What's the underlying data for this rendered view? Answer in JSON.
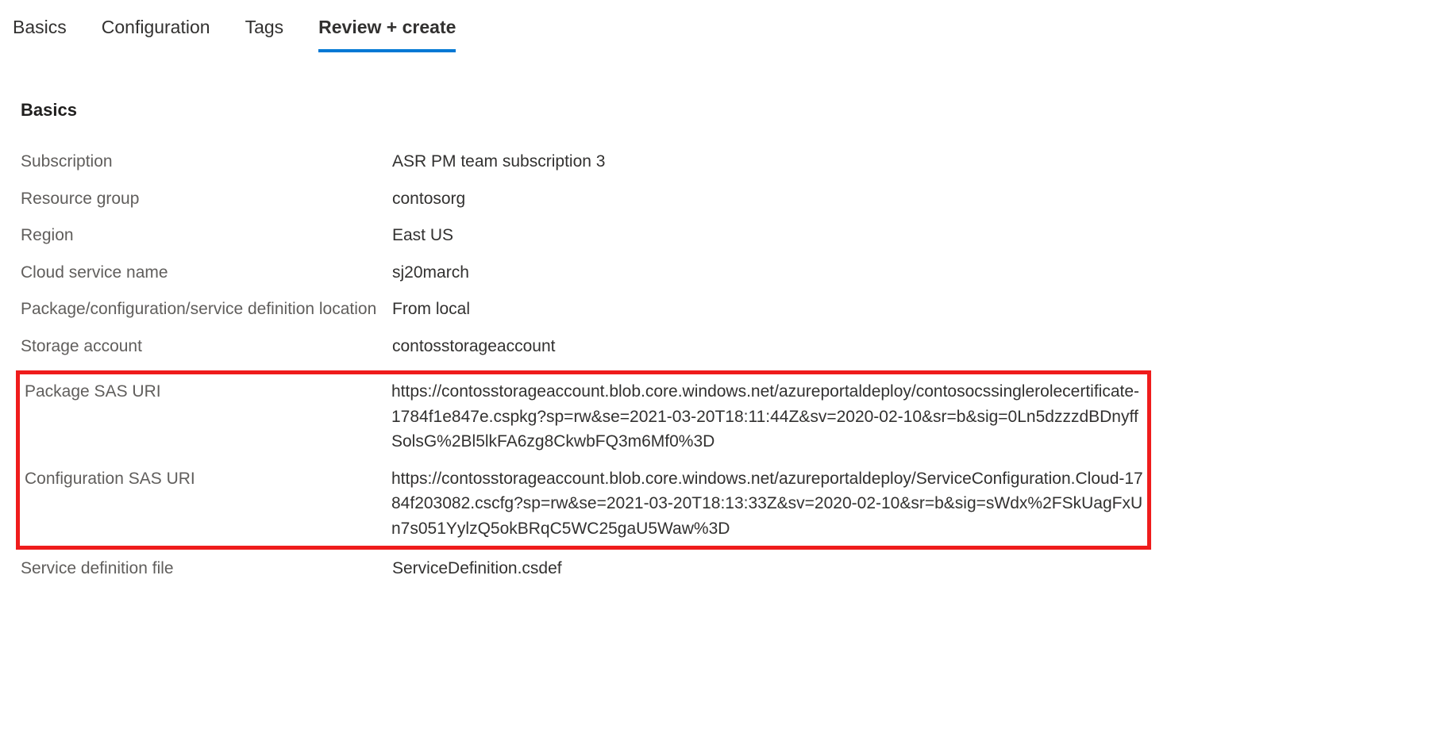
{
  "tabs": [
    {
      "label": "Basics",
      "active": false
    },
    {
      "label": "Configuration",
      "active": false
    },
    {
      "label": "Tags",
      "active": false
    },
    {
      "label": "Review + create",
      "active": true
    }
  ],
  "section_heading": "Basics",
  "rows": {
    "subscription": {
      "label": "Subscription",
      "value": "ASR PM team subscription 3"
    },
    "resource_group": {
      "label": "Resource group",
      "value": "contosorg"
    },
    "region": {
      "label": "Region",
      "value": "East US"
    },
    "cloud_service_name": {
      "label": "Cloud service name",
      "value": "sj20march"
    },
    "pkg_loc": {
      "label": "Package/configuration/service definition location",
      "value": "From local"
    },
    "storage_account": {
      "label": "Storage account",
      "value": "contosstorageaccount"
    },
    "package_sas_uri": {
      "label": "Package SAS URI",
      "value": "https://contosstorageaccount.blob.core.windows.net/azureportaldeploy/contosocssinglerolecertificate-1784f1e847e.cspkg?sp=rw&se=2021-03-20T18:11:44Z&sv=2020-02-10&sr=b&sig=0Ln5dzzzdBDnyffSolsG%2Bl5lkFA6zg8CkwbFQ3m6Mf0%3D"
    },
    "config_sas_uri": {
      "label": "Configuration SAS URI",
      "value": "https://contosstorageaccount.blob.core.windows.net/azureportaldeploy/ServiceConfiguration.Cloud-1784f203082.cscfg?sp=rw&se=2021-03-20T18:13:33Z&sv=2020-02-10&sr=b&sig=sWdx%2FSkUagFxUn7s051YylzQ5okBRqC5WC25gaU5Waw%3D"
    },
    "service_def_file": {
      "label": "Service definition file",
      "value": "ServiceDefinition.csdef"
    }
  }
}
